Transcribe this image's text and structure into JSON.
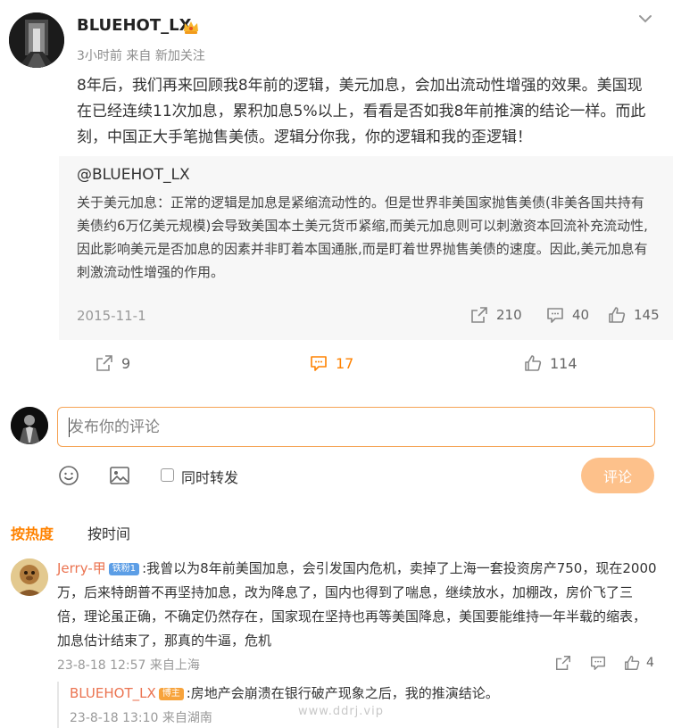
{
  "post": {
    "author": "BLUEHOT_LX",
    "time": "3小时前",
    "source": "来自 新加关注",
    "text": "8年后，我们再来回顾我8年前的逻辑，美元加息，会加出流动性增强的效果。美国现在已经连续11次加息，累积加息5%以上，看看是否如我8年前推演的结论一样。而此刻，中国正大手笔抛售美债。逻辑分你我，你的逻辑和我的歪逻辑！",
    "icons": {
      "menu": "chevron-down-icon",
      "author_badge": "crown-icon"
    }
  },
  "quoted": {
    "author": "@BLUEHOT_LX",
    "text": "关于美元加息：正常的逻辑是加息是紧缩流动性的。但是世界非美国家抛售美债(非美各国共持有美债约6万亿美元规模)会导致美国本土美元货币紧缩,而美元加息则可以刺激资本回流补充流动性,因此影响美元是否加息的因素并非盯着本国通胀,而是盯着世界抛售美债的速度。因此,美元加息有刺激流动性增强的作用。",
    "date": "2015-11-1",
    "reposts": "210",
    "comments": "40",
    "likes": "145"
  },
  "actions": {
    "reposts": "9",
    "comments": "17",
    "likes": "114",
    "active_color": "#ff8200"
  },
  "composer": {
    "placeholder": "发布你的评论",
    "repost_label": "同时转发",
    "submit_label": "评论",
    "icons": [
      "emoji-icon",
      "image-icon"
    ]
  },
  "sort": {
    "hot": "按热度",
    "time": "按时间"
  },
  "comments": [
    {
      "user": "Jerry-甲",
      "badge": "铁粉1",
      "text": ":我曾以为8年前美国加息，会引发国内危机，卖掉了上海一套投资房产750，现在2000万，后来特朗普不再坚持加息，改为降息了，国内也得到了喘息，继续放水，加棚改，房价飞了三倍，理论虽正确，不确定仍然存在，国家现在坚持也再等美国降息，美国要能维持一年半载的缩表，加息估计结束了，那真的牛逼，危机",
      "time": "23-8-18 12:57",
      "location": "来自上海",
      "likes": "4",
      "reply": {
        "user": "BLUEHOT_LX",
        "badge": "博主",
        "text": ":房地产会崩溃在银行破产现象之后，我的推演结论。",
        "time": "23-8-18 13:10",
        "location": "来自湖南"
      }
    }
  ],
  "watermark": "www.ddrj.vip"
}
